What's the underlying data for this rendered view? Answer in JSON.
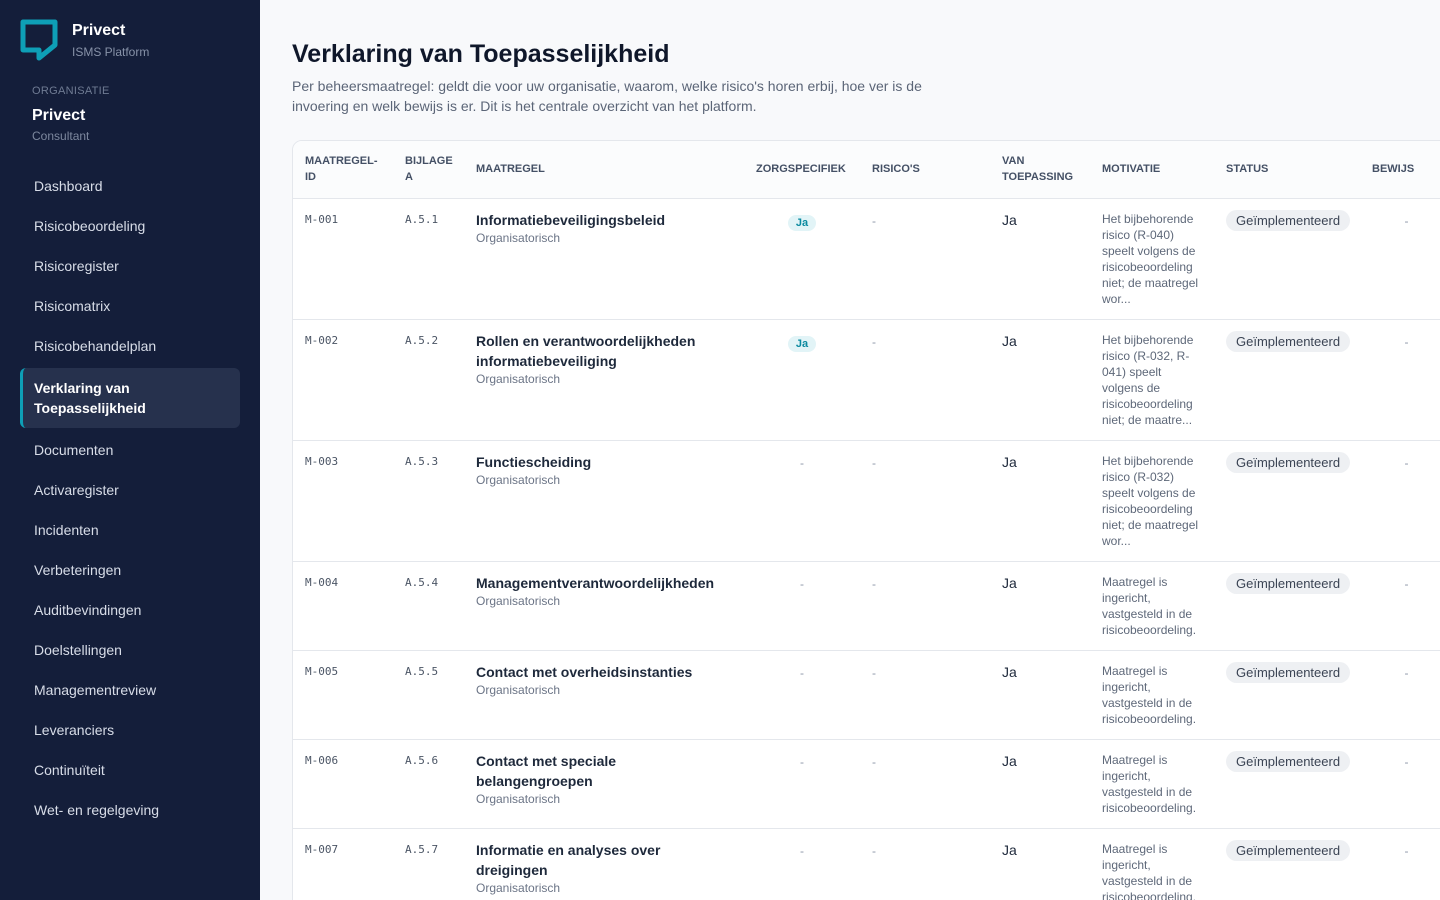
{
  "brand": {
    "name": "Privect",
    "subtitle": "ISMS Platform",
    "logo_color": "#0e9fb6"
  },
  "organization": {
    "label": "Organisatie",
    "name": "Privect",
    "role": "Consultant"
  },
  "nav": [
    {
      "label": "Dashboard",
      "key": "dashboard"
    },
    {
      "label": "Risicobeoordeling",
      "key": "risicobeoordeling"
    },
    {
      "label": "Risicoregister",
      "key": "risicoregister"
    },
    {
      "label": "Risicomatrix",
      "key": "risicomatrix"
    },
    {
      "label": "Risicobehandelplan",
      "key": "risicobehandelplan"
    },
    {
      "label": "Verklaring van Toepasselijkheid",
      "key": "verklaring",
      "active": true
    },
    {
      "label": "Documenten",
      "key": "documenten"
    },
    {
      "label": "Activaregister",
      "key": "activaregister"
    },
    {
      "label": "Incidenten",
      "key": "incidenten"
    },
    {
      "label": "Verbeteringen",
      "key": "verbeteringen"
    },
    {
      "label": "Auditbevindingen",
      "key": "auditbevindingen"
    },
    {
      "label": "Doelstellingen",
      "key": "doelstellingen"
    },
    {
      "label": "Managementreview",
      "key": "managementreview"
    },
    {
      "label": "Leveranciers",
      "key": "leveranciers"
    },
    {
      "label": "Continuïteit",
      "key": "continuiteit"
    },
    {
      "label": "Wet- en regelgeving",
      "key": "wetgeving"
    }
  ],
  "page": {
    "title": "Verklaring van Toepasselijkheid",
    "description": "Per beheersmaatregel: geldt die voor uw organisatie, waarom, welke risico's horen erbij, hoe ver is de invoering en welk bewijs is er. Dit is het centrale overzicht van het platform."
  },
  "table": {
    "headers": {
      "id": "Maatregel-ID",
      "annex": "Bijlage A",
      "control": "Maatregel",
      "care": "Zorgspecifiek",
      "risks": "Risico's",
      "applicable": "Van toepassing",
      "motivation": "Motivatie",
      "status": "Status",
      "evidence": "Bewijs"
    },
    "rows": [
      {
        "id": "M-001",
        "annex": "A.5.1",
        "name": "Informatiebeveiligingsbeleid",
        "category": "Organisatorisch",
        "care": "Ja",
        "risks": "-",
        "applicable": "Ja",
        "motivation": "Het bijbehorende risico (R-040) speelt volgens de risicobeoordeling niet; de maatregel wor...",
        "status": "Geïmplementeerd",
        "evidence": "-"
      },
      {
        "id": "M-002",
        "annex": "A.5.2",
        "name": "Rollen en verantwoordelijkheden informatiebeveiliging",
        "category": "Organisatorisch",
        "care": "Ja",
        "risks": "-",
        "applicable": "Ja",
        "motivation": "Het bijbehorende risico (R-032, R-041) speelt volgens de risicobeoordeling niet; de maatre...",
        "status": "Geïmplementeerd",
        "evidence": "-"
      },
      {
        "id": "M-003",
        "annex": "A.5.3",
        "name": "Functiescheiding",
        "category": "Organisatorisch",
        "care": "-",
        "risks": "-",
        "applicable": "Ja",
        "motivation": "Het bijbehorende risico (R-032) speelt volgens de risicobeoordeling niet; de maatregel wor...",
        "status": "Geïmplementeerd",
        "evidence": "-"
      },
      {
        "id": "M-004",
        "annex": "A.5.4",
        "name": "Managementverantwoordelijkheden",
        "category": "Organisatorisch",
        "care": "-",
        "risks": "-",
        "applicable": "Ja",
        "motivation": "Maatregel is ingericht, vastgesteld in de risicobeoordeling.",
        "status": "Geïmplementeerd",
        "evidence": "-"
      },
      {
        "id": "M-005",
        "annex": "A.5.5",
        "name": "Contact met overheidsinstanties",
        "category": "Organisatorisch",
        "care": "-",
        "risks": "-",
        "applicable": "Ja",
        "motivation": "Maatregel is ingericht, vastgesteld in de risicobeoordeling.",
        "status": "Geïmplementeerd",
        "evidence": "-"
      },
      {
        "id": "M-006",
        "annex": "A.5.6",
        "name": "Contact met speciale belangengroepen",
        "category": "Organisatorisch",
        "care": "-",
        "risks": "-",
        "applicable": "Ja",
        "motivation": "Maatregel is ingericht, vastgesteld in de risicobeoordeling.",
        "status": "Geïmplementeerd",
        "evidence": "-"
      },
      {
        "id": "M-007",
        "annex": "A.5.7",
        "name": "Informatie en analyses over dreigingen",
        "category": "Organisatorisch",
        "care": "-",
        "risks": "-",
        "applicable": "Ja",
        "motivation": "Maatregel is ingericht, vastgesteld in de risicobeoordeling.",
        "status": "Geïmplementeerd",
        "evidence": "-"
      }
    ]
  }
}
